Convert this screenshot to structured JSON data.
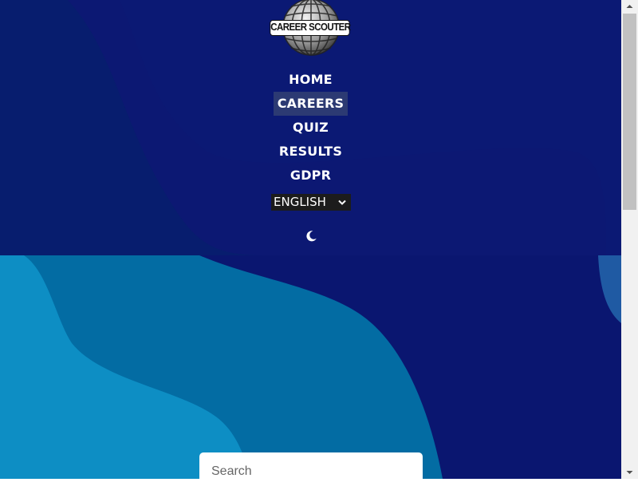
{
  "logo": {
    "text": "CAREER SCOUTER"
  },
  "nav": {
    "items": [
      {
        "label": "HOME",
        "active": false
      },
      {
        "label": "CAREERS",
        "active": true
      },
      {
        "label": "QUIZ",
        "active": false
      },
      {
        "label": "RESULTS",
        "active": false
      },
      {
        "label": "GDPR",
        "active": false
      }
    ]
  },
  "language": {
    "selected": "ENGLISH",
    "chevron": "⌄"
  },
  "theme_toggle": {
    "icon": "moon-icon"
  },
  "search": {
    "placeholder": "Search",
    "value": ""
  },
  "colors": {
    "header_bg": "#0a1670",
    "nav_active_bg": "#2c3a73",
    "wave_light": "#0d8ec4",
    "wave_mid": "#036ca3",
    "wave_dark": "#0a1670",
    "language_bg": "#1c1c1c"
  }
}
